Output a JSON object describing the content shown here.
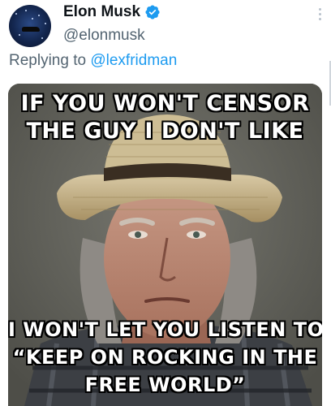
{
  "tweet": {
    "display_name": "Elon Musk",
    "handle": "@elonmusk",
    "reply_prefix": "Replying to ",
    "reply_to": "@lexfridman"
  },
  "meme": {
    "top_line_1": "IF YOU WON'T CENSOR",
    "top_line_2": "THE GUY I DON'T LIKE",
    "bottom_line_1": "I WON'T LET YOU LISTEN TO",
    "bottom_line_2": "“KEEP ON ROCKING IN THE",
    "bottom_line_3": "FREE WORLD”"
  },
  "icons": {
    "verified": "verified-badge-icon",
    "more": "more-options-icon"
  },
  "colors": {
    "accent": "#1d9bf0",
    "text_primary": "#0f1419",
    "text_secondary": "#536471"
  }
}
